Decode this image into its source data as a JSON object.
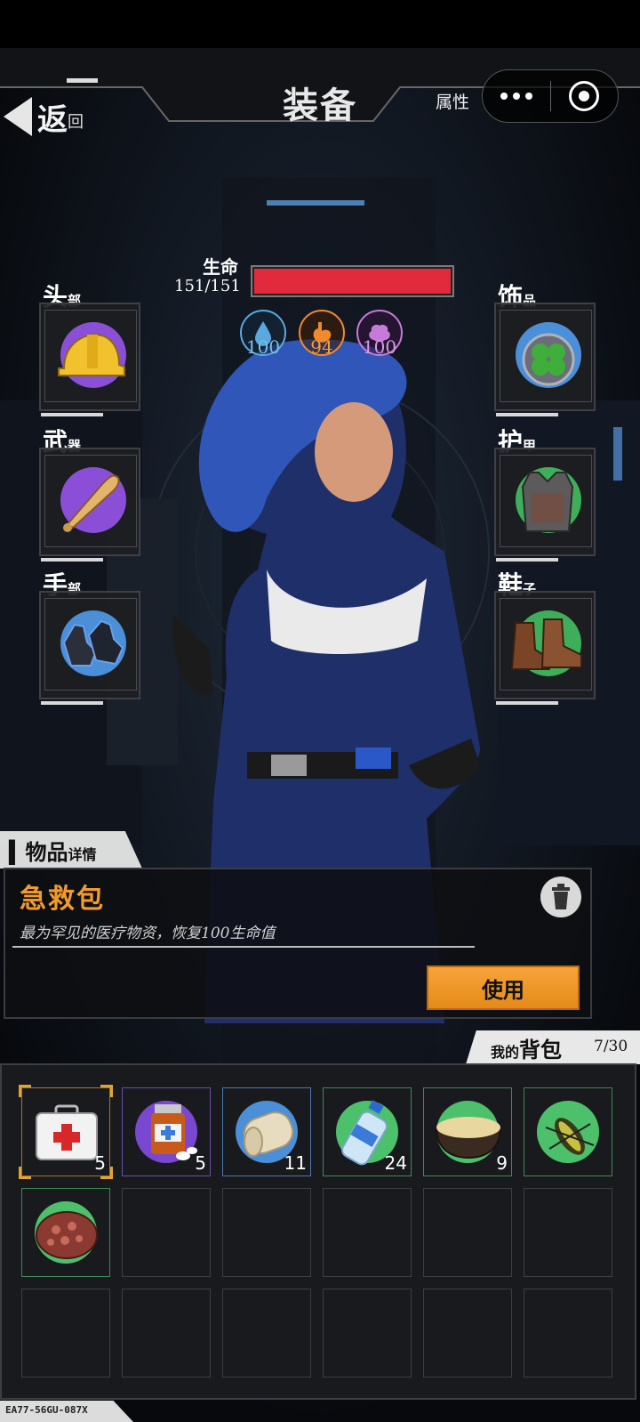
{
  "header": {
    "back_label_big": "返",
    "back_label_small": "回",
    "title": "装备",
    "attribute_tab": "属性"
  },
  "stats": {
    "life_label": "生命",
    "life_value": "151/151",
    "life_fraction": 1.0,
    "water": "100",
    "hunger": "94",
    "sanity": "100",
    "colors": {
      "life": "#e12b3c",
      "water": "#5aa8e0",
      "hunger": "#f08a2c",
      "sanity": "#c77ad8"
    }
  },
  "equipment": {
    "head": {
      "label_big": "头",
      "label_small": "部",
      "icon": "hardhat-icon"
    },
    "weapon": {
      "label_big": "武",
      "label_small": "器",
      "icon": "baseball-bat-icon"
    },
    "hands": {
      "label_big": "手",
      "label_small": "部",
      "icon": "gloves-icon"
    },
    "accessory": {
      "label_big": "饰",
      "label_small": "品",
      "icon": "clover-charm-icon"
    },
    "armor": {
      "label_big": "护",
      "label_small": "甲",
      "icon": "vest-icon"
    },
    "shoes": {
      "label_big": "鞋",
      "label_small": "子",
      "icon": "boots-icon"
    }
  },
  "detail": {
    "tab_big": "物品",
    "tab_small": "详情",
    "item_name": "急救包",
    "item_desc": "最为罕见的医疗物资，恢复100生命值",
    "use_button": "使用"
  },
  "backpack": {
    "title_small": "我的",
    "title_big": "背包",
    "count": "7/30",
    "items": [
      {
        "icon": "first-aid-kit-icon",
        "qty": "5",
        "selected": true
      },
      {
        "icon": "pill-bottle-icon",
        "qty": "5"
      },
      {
        "icon": "bandage-icon",
        "qty": "11"
      },
      {
        "icon": "water-bottle-icon",
        "qty": "24"
      },
      {
        "icon": "porridge-bowl-icon",
        "qty": "9"
      },
      {
        "icon": "insect-icon",
        "qty": ""
      },
      {
        "icon": "raw-meat-icon",
        "qty": ""
      }
    ]
  },
  "footer_code": "EA77-56GU-087X"
}
